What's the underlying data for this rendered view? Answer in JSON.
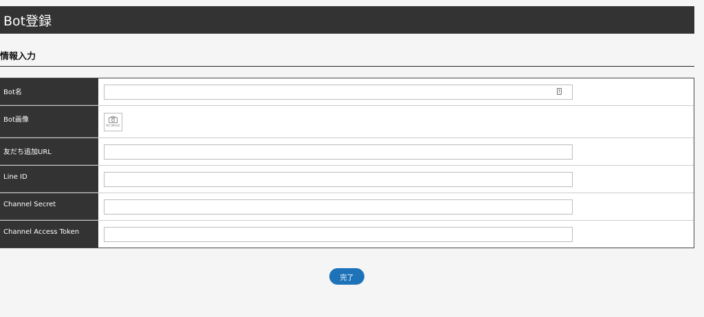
{
  "header": {
    "title": "Bot登録"
  },
  "section": {
    "title": "情報入力"
  },
  "form": {
    "rows": [
      {
        "label": "Bot名",
        "type": "text",
        "value": ""
      },
      {
        "label": "Bot画像",
        "type": "image",
        "placeholder_text": "NO IMAGE"
      },
      {
        "label": "友だち追加URL",
        "type": "text",
        "value": ""
      },
      {
        "label": "Line ID",
        "type": "text",
        "value": ""
      },
      {
        "label": "Channel Secret",
        "type": "text",
        "value": ""
      },
      {
        "label": "Channel Access Token",
        "type": "text",
        "value": ""
      }
    ]
  },
  "actions": {
    "submit_label": "完了"
  },
  "colors": {
    "header_bg": "#333333",
    "label_bg": "#333333",
    "accent": "#1e72b8",
    "page_bg": "#f5f5f5"
  },
  "icons": {
    "bot_name_field": "info-badge-icon",
    "image_placeholder": "camera-icon"
  }
}
